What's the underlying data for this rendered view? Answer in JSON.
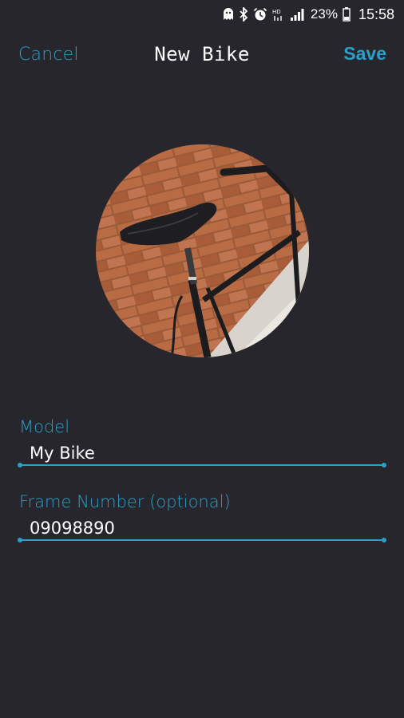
{
  "status_bar": {
    "battery_percent": "23%",
    "time": "15:58",
    "icons": [
      "ghost-notification-icon",
      "bluetooth-icon",
      "alarm-icon",
      "hd-voice-icon",
      "signal-icon",
      "battery-icon"
    ]
  },
  "header": {
    "cancel_label": "Cancel",
    "title": "New Bike",
    "save_label": "Save"
  },
  "photo": {
    "subject": "bike-photo"
  },
  "form": {
    "model": {
      "label": "Model",
      "value": "My Bike"
    },
    "frame_number": {
      "label": "Frame Number (optional)",
      "value": "09098890"
    }
  },
  "colors": {
    "background": "#27262d",
    "accent": "#2aa0c8",
    "text": "#ffffff"
  }
}
